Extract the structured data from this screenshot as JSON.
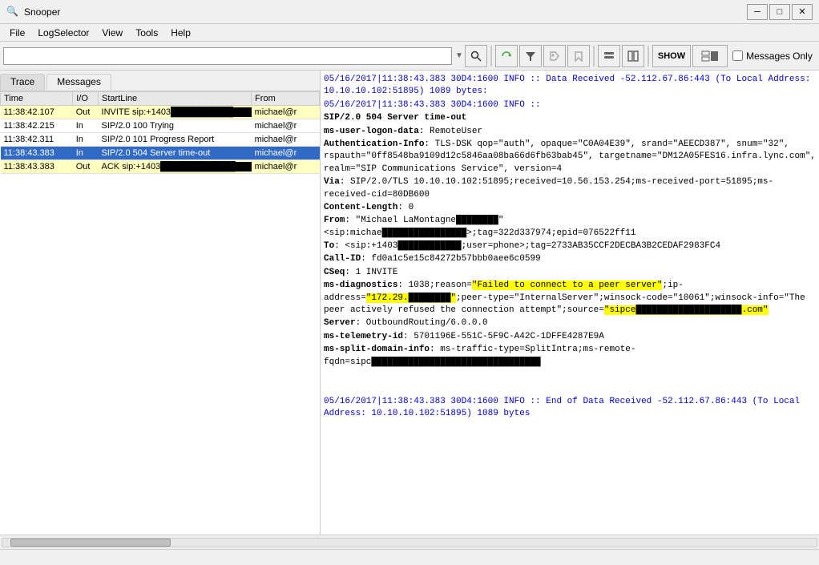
{
  "app": {
    "title": "Snooper",
    "icon": "🔍"
  },
  "titlebar": {
    "minimize": "─",
    "maximize": "□",
    "close": "✕"
  },
  "menu": {
    "items": [
      "File",
      "LogSelector",
      "View",
      "Tools",
      "Help"
    ]
  },
  "toolbar": {
    "combo_placeholder": "",
    "search_icon": "🔍",
    "filter_icon": "▼",
    "messages_only_label": "Messages Only",
    "show_label": "SHOW"
  },
  "tabs": {
    "trace": "Trace",
    "messages": "Messages"
  },
  "table": {
    "headers": [
      "Time",
      "I/O",
      "StartLine",
      "From"
    ],
    "rows": [
      {
        "time": "11:38:42.107",
        "io": "Out",
        "startline": "INVITE sip:+1403",
        "from": "michael@r",
        "style": "out"
      },
      {
        "time": "11:38:42.215",
        "io": "In",
        "startline": "SIP/2.0 100 Trying",
        "from": "michael@r",
        "style": "in"
      },
      {
        "time": "11:38:42.311",
        "io": "In",
        "startline": "SIP/2.0 101 Progress Report",
        "from": "michael@r",
        "style": "in"
      },
      {
        "time": "11:38:43.383",
        "io": "In",
        "startline": "SIP/2.0 504 Server time-out",
        "from": "michael@r",
        "style": "selected"
      },
      {
        "time": "11:38:43.383",
        "io": "Out",
        "startline": "ACK sip:+1403",
        "from": "michael@r",
        "style": "out"
      }
    ]
  },
  "detail": {
    "lines": [
      {
        "type": "info",
        "text": "05/16/2017|11:38:43.383 30D4:1600 INFO  :: Data Received -52.112.67.86:443 (To Local Address: 10.10.10.102:51895) 1089 bytes:"
      },
      {
        "type": "info",
        "text": "05/16/2017|11:38:43.383 30D4:1600 INFO  ::"
      },
      {
        "type": "sip",
        "text": "SIP/2.0 504 Server time-out"
      },
      {
        "type": "header",
        "label": "ms-user-logon-data",
        "value": ": RemoteUser"
      },
      {
        "type": "header",
        "label": "Authentication-Info",
        "value": ": TLS-DSK qop=\"auth\", opaque=\"C0A04E39\", srand=\"AEECD387\", snum=\"32\", rspauth=\"0ff8548ba9109d12c5846aa08ba66d6fb63bab45\", targetname=\"DM12A05FES16.infra.lync.com\", realm=\"SIP Communications Service\", version=4"
      },
      {
        "type": "header",
        "label": "Via",
        "value": ": SIP/2.0/TLS 10.10.10.102:51895;received=10.56.153.254;ms-received-port=51895;ms-received-cid=80DB600"
      },
      {
        "type": "header",
        "label": "Content-Length",
        "value": ": 0"
      },
      {
        "type": "header",
        "label": "From",
        "value": ": \"Michael LaMontagne████████\" <sip:michae████████████████>;tag=322d337974;epid=076522ff11"
      },
      {
        "type": "header",
        "label": "To",
        "value": ": <sip:+1403████████████;user=phone>;tag=2733AB35CCF2DECBA3B2CEDAF2983FC4"
      },
      {
        "type": "header",
        "label": "Call-ID",
        "value": ": fd0a1c5e15c84272b57bbb0aee6c0599"
      },
      {
        "type": "header",
        "label": "CSeq",
        "value": ": 1 INVITE"
      },
      {
        "type": "header-highlight",
        "label": "ms-diagnostics",
        "value": ": 1038;reason=\"Failed to connect to a peer server\";ip-address=\"172.29.████████\";peer-type=\"InternalServer\";winsock-code=\"10061\";winsock-info=\"The peer actively refused the connection attempt\";source=\"sipce████████████████████.com\""
      },
      {
        "type": "header",
        "label": "Server",
        "value": ": OutboundRouting/6.0.0.0"
      },
      {
        "type": "header",
        "label": "ms-telemetry-id",
        "value": ": 5701196E-551C-5F9C-A42C-1DFFE4287E9A"
      },
      {
        "type": "header",
        "label": "ms-split-domain-info",
        "value": ": ms-traffic-type=SplitIntra;ms-remote-fqdn=sipc████████████████████████████████"
      },
      {
        "type": "blank"
      },
      {
        "type": "blank"
      },
      {
        "type": "info",
        "text": "05/16/2017|11:38:43.383 30D4:1600 INFO  :: End of Data Received -52.112.67.86:443 (To Local Address: 10.10.10.102:51895) 1089 bytes"
      }
    ]
  },
  "statusbar": {
    "text": ""
  }
}
